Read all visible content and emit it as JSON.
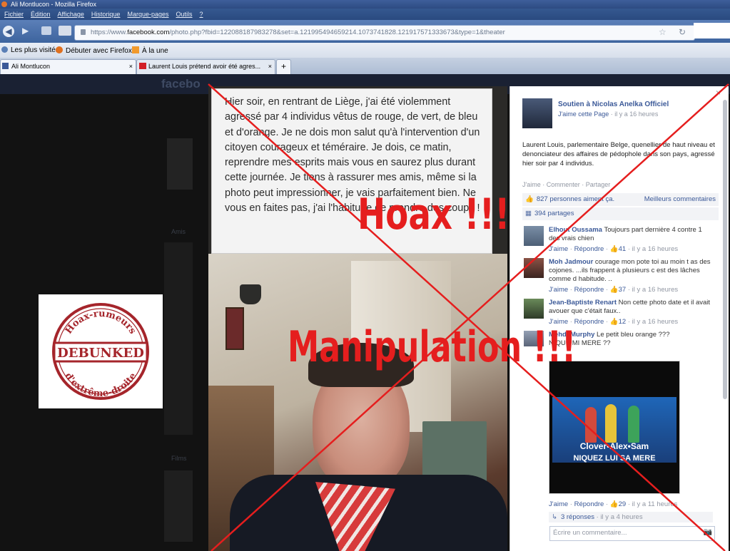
{
  "window": {
    "title": "Ali Montlucon - Mozilla Firefox"
  },
  "menu": [
    "Fichier",
    "Édition",
    "Affichage",
    "Historique",
    "Marque-pages",
    "Outils",
    "?"
  ],
  "url": {
    "prefix": "https://www.",
    "domain": "facebook.com",
    "path": "/photo.php?fbid=122088187983278&set=a.121995494659214.1073741828.121917571333673&type=1&theater"
  },
  "bookmarks": [
    "Les plus visités",
    "Débuter avec Firefox",
    "À la une"
  ],
  "tabs": [
    {
      "label": "Ali Montlucon"
    },
    {
      "label": "Laurent Louis prétend avoir été agres..."
    }
  ],
  "new_tab": "+",
  "page": {
    "logo": "facebo",
    "left_labels": [
      "Amis",
      "Films"
    ]
  },
  "stamp": {
    "top": "Hoax-rumeurs",
    "center": "DEBUNKED",
    "bottom": "d'extrême-droite"
  },
  "post_text": "Hier soir, en rentrant de Liège, j'ai été violemment agressé par 4 individus vêtus de rouge, de vert, de bleu et d'orange. Je ne dois mon salut qu'à l'intervention d'un citoyen courageux et téméraire. Je dois, ce matin, reprendre mes esprits mais vous en saurez plus durant cette journée. Je tiens à rassurer mes amis, même si la photo peut impressionner, je vais parfaitement bien. Ne vous en faites pas, j'ai l'habitude de prendre des coups !",
  "side": {
    "page_name": "Soutien à Nicolas Anelka Officiel",
    "page_like": "J'aime cette Page",
    "page_time": "il y a 16 heures",
    "caption": "Laurent Louis, parlementaire Belge, quenellier de haut niveau et denonciateur des affaires de pédophole dans son pays, agressé hier soir par 4 individus.",
    "actions": "J'aime · Commenter · Partager",
    "likes": "827 personnes aiment ça.",
    "top_comments": "Meilleurs commentaires",
    "shares": "394 partages",
    "comments": [
      {
        "name": "Elhout Oussama",
        "text": "Toujours part dernière 4 contre 1 des vrais chien",
        "like": "J'aime",
        "reply": "Répondre",
        "count": "41",
        "time": "il y a 16 heures"
      },
      {
        "name": "Moh Jadmour",
        "text": "courage mon pote toi au moin t as des cojones. ...ils frappent à plusieurs c est des lâches comme d habitude. ..",
        "like": "J'aime",
        "reply": "Répondre",
        "count": "37",
        "time": "il y a 16 heures"
      },
      {
        "name": "Jean-Baptiste Renart",
        "text": "Non cette photo date et il avait avouer que c'était faux..",
        "like": "J'aime",
        "reply": "Répondre",
        "count": "12",
        "time": "il y a 16 heures"
      },
      {
        "name": "Mehdi Murphy",
        "text": "Le petit bleu orange ???",
        "text2": "NIQUE MI MERE ??",
        "like": "J'aime",
        "reply": "Répondre",
        "count": "29",
        "time": "il y a 11 heures"
      }
    ],
    "meme_top": "Clover•Alex•Sam",
    "meme_bottom": "NIQUEZ LUI SA MERE",
    "replies": "3 réponses",
    "replies_time": "il y a 4 heures",
    "comment_placeholder": "Écrire un commentaire..."
  },
  "overlay": {
    "hoax": "Hoax !!!",
    "manip": "Manipulation !!!"
  },
  "colors": {
    "overlay_red": "#e51e1e",
    "fb_blue": "#3b5998",
    "stamp_red": "#a5252b"
  }
}
